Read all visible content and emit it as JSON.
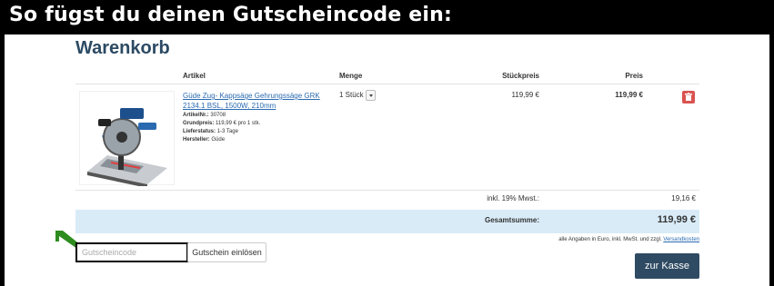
{
  "banner": {
    "title": "So fügst du deinen Gutscheincode ein:"
  },
  "cart": {
    "title": "Warenkorb",
    "columns": {
      "article": "Artikel",
      "quantity": "Menge",
      "unit_price": "Stückpreis",
      "price": "Preis"
    },
    "items": [
      {
        "name": "Güde Zug- Kappsäge Gehrungssäge GRK 2134.1 BSL, 1500W, 210mm",
        "meta": [
          {
            "label": "ArtikelNr.:",
            "value": "30708"
          },
          {
            "label": "Grundpreis:",
            "value": "119,99 € pro 1 stk."
          },
          {
            "label": "Lieferstatus:",
            "value": "1-3 Tage"
          },
          {
            "label": "Hersteller:",
            "value": "Güde"
          }
        ],
        "quantity": "1 Stück",
        "unit_price": "119,99 €",
        "price": "119,99 €"
      }
    ],
    "tax": {
      "label": "inkl. 19% Mwst.:",
      "value": "19,16 €"
    },
    "total": {
      "label": "Gesamtsumme:",
      "value": "119,99 €"
    },
    "note": {
      "text": "alle Angaben in Euro, inkl. MwSt. und zzgl.",
      "link": "Versandkosten"
    },
    "coupon": {
      "placeholder": "Gutscheincode",
      "button": "Gutschein einlösen"
    },
    "checkout_label": "zur Kasse"
  },
  "colors": {
    "accent": "#2f4b63",
    "total_bar": "#d9ebf7",
    "delete": "#d9534f",
    "arrow": "#2e8b1e",
    "link": "#2a6ab0"
  },
  "icons": {
    "delete": "trash-icon",
    "dropdown": "chevron-down-icon",
    "pointer": "arrow-icon"
  }
}
